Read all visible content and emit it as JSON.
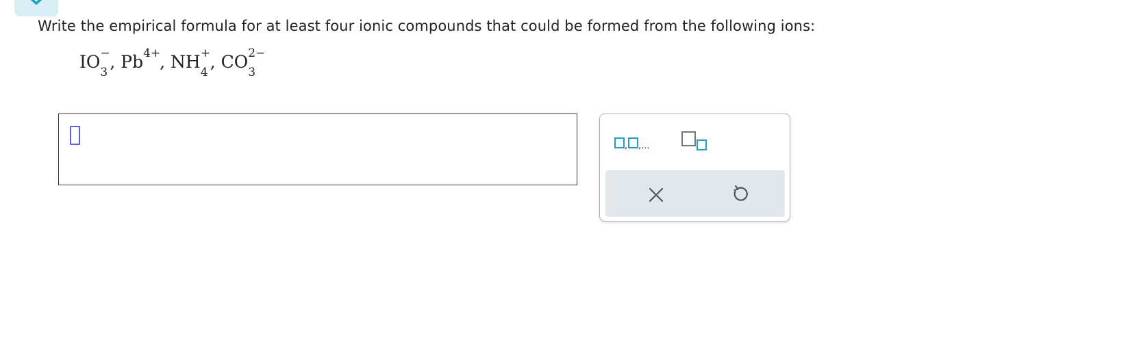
{
  "prompt": "Write the empirical formula for at least four ionic compounds that could be formed from the following ions:",
  "ions": [
    {
      "base": "IO",
      "sub": "3",
      "sup": "−",
      "sep": ", "
    },
    {
      "base": "Pb",
      "sub": "",
      "sup": "4+",
      "sep": ", "
    },
    {
      "base": "NH",
      "sub": "4",
      "sup": "+",
      "sep": ", "
    },
    {
      "base": "CO",
      "sub": "3",
      "sup": "2−",
      "sep": ""
    }
  ],
  "answer": {
    "value": ""
  },
  "toolbar": {
    "list_tool_icon": "list-template-icon",
    "subscript_tool_icon": "subscript-template-icon",
    "clear_icon": "clear-x-icon",
    "undo_icon": "undo-icon"
  },
  "colors": {
    "accent": "#1d9fbf",
    "tab_bg": "#d7eef4",
    "cursor": "#5a5ce6",
    "action_bar": "#e1e7ea"
  }
}
